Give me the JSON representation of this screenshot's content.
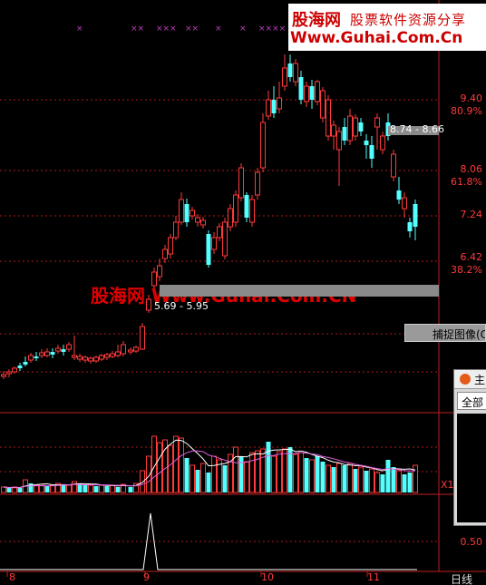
{
  "chart_data": [
    {
      "type": "candlestick",
      "title": "",
      "y_axis_labels": [
        {
          "price": "9.40",
          "pct": "80.9%"
        },
        {
          "price": "8.06",
          "pct": "61.8%"
        },
        {
          "price": "7.24",
          "pct": ""
        },
        {
          "price": "6.42",
          "pct": "38.2%"
        }
      ],
      "annotations": [
        "8.74 - 8.66",
        "5.69 - 5.95"
      ],
      "x_tick_labels": [
        "8",
        "9",
        "10",
        "11"
      ]
    },
    {
      "type": "bar",
      "title": "",
      "description_label": "X1",
      "note": "volume panel"
    },
    {
      "type": "line",
      "title": "",
      "y_axis_labels": [
        "0.50"
      ]
    }
  ],
  "watermark_top": {
    "brand": "股海网",
    "slogan": "股票软件资源分享",
    "url": "Www.Guhai.Com.Cn"
  },
  "watermark_mid": "股海网 Www.Guhai.Com.CN",
  "capture_button": "捕捉图像(C",
  "side_panel": {
    "title": "主",
    "tab": "全部"
  },
  "period_label": "日线",
  "markers": [
    "×",
    "××",
    "×××",
    "××",
    "×",
    "×",
    "××××"
  ]
}
